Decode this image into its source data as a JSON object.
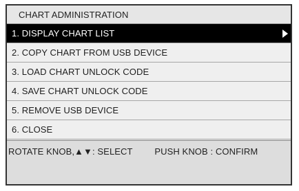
{
  "menu": {
    "title": "CHART ADMINISTRATION",
    "items": [
      {
        "label": "1. DISPLAY CHART LIST",
        "selected": true,
        "has_submenu": true
      },
      {
        "label": "2. COPY CHART FROM USB DEVICE",
        "selected": false
      },
      {
        "label": "3. LOAD CHART UNLOCK CODE",
        "selected": false
      },
      {
        "label": "4. SAVE CHART UNLOCK CODE",
        "selected": false
      },
      {
        "label": "5. REMOVE USB DEVICE",
        "selected": false
      },
      {
        "label": "6. CLOSE",
        "selected": false
      }
    ]
  },
  "help": {
    "select_text": "ROTATE KNOB,▲▼: SELECT",
    "confirm_text": "PUSH KNOB : CONFIRM"
  },
  "icons": {
    "submenu": "triangle-right-icon"
  },
  "colors": {
    "selected_bg": "#000000",
    "selected_fg": "#ffffff",
    "item_bg": "#efefef",
    "help_bg": "#dddddd"
  }
}
